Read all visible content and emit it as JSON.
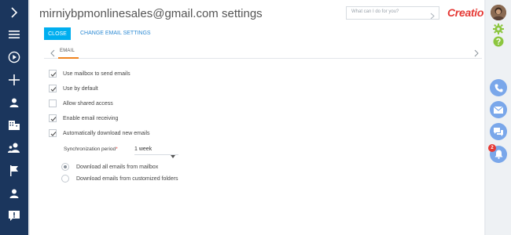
{
  "page": {
    "title": "mirniybpmonlinesales@gmail.com settings",
    "brand": "Creatio"
  },
  "search": {
    "placeholder": "What can I do for you?"
  },
  "actions": {
    "close_label": "CLOSE",
    "change_label": "CHANGE EMAIL SETTINGS"
  },
  "tabs": {
    "active_label": "EMAIL"
  },
  "options": [
    {
      "label": "Use mailbox to send emails",
      "checked": true
    },
    {
      "label": "Use by default",
      "checked": true
    },
    {
      "label": "Allow shared access",
      "checked": false
    },
    {
      "label": "Enable email receiving",
      "checked": true
    },
    {
      "label": "Automatically download new emails",
      "checked": true
    }
  ],
  "sync": {
    "label": "Synchronization period",
    "required_mark": "*",
    "value": "1 week"
  },
  "download_mode": [
    {
      "label": "Download all emails from mailbox",
      "selected": true
    },
    {
      "label": "Download emails from customized folders",
      "selected": false
    }
  ],
  "notifications": {
    "count": "2"
  },
  "colors": {
    "nav_bg": "#1b365d",
    "accent": "#00aeef",
    "brand": "#e53935",
    "tab_underline": "#f0841f",
    "right_icons": "#7aa7ea",
    "settings_green": "#8cc63f"
  }
}
